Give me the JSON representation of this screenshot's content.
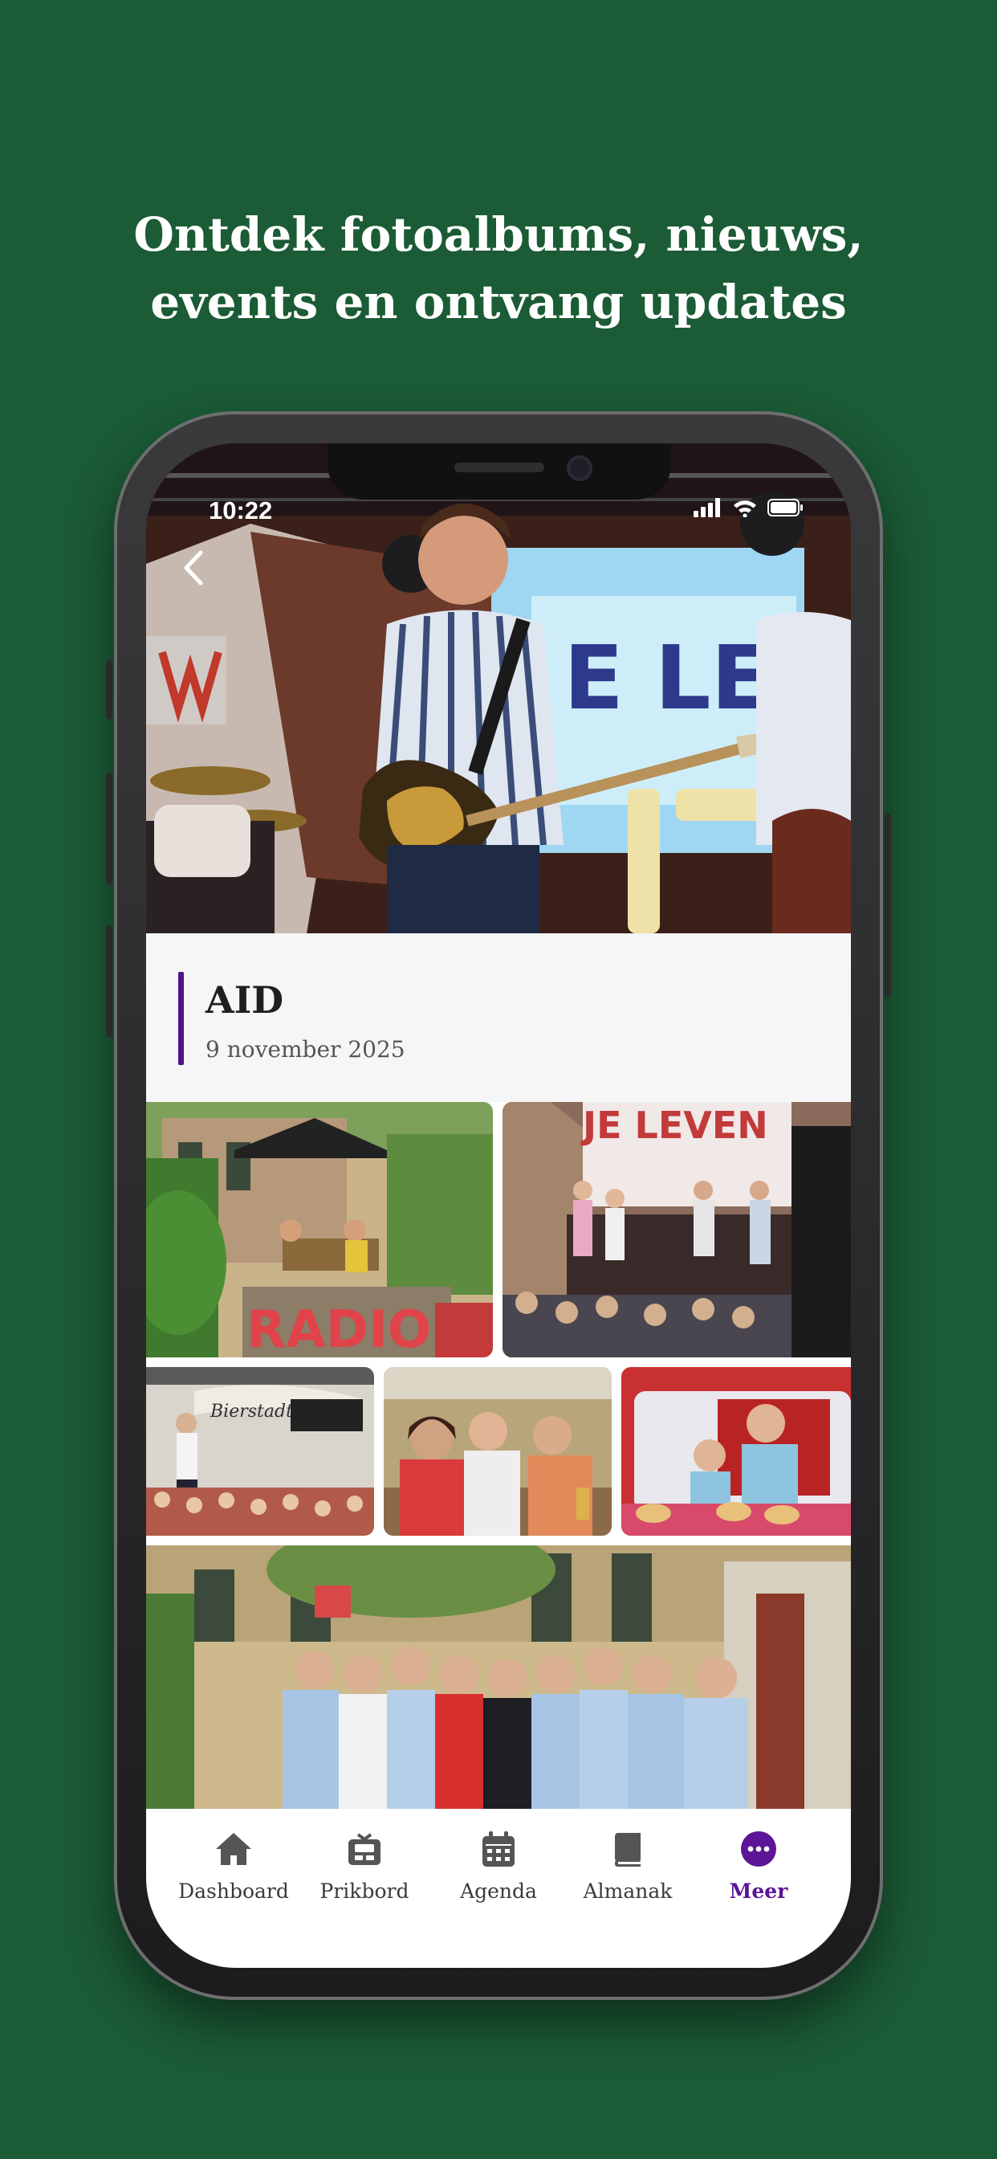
{
  "headline": {
    "line1": "Ontdek fotoalbums, nieuws,",
    "line2": "events en ontvang updates"
  },
  "status_bar": {
    "time": "10:22"
  },
  "album": {
    "title": "AID",
    "date": "9 november 2025"
  },
  "tabs": [
    {
      "label": "Dashboard",
      "icon": "home-icon",
      "active": false
    },
    {
      "label": "Prikbord",
      "icon": "board-icon",
      "active": false
    },
    {
      "label": "Agenda",
      "icon": "calendar-icon",
      "active": false
    },
    {
      "label": "Almanak",
      "icon": "book-icon",
      "active": false
    },
    {
      "label": "Meer",
      "icon": "more-icon",
      "active": true
    }
  ],
  "colors": {
    "background": "#1b5b35",
    "accent": "#4f138a",
    "active_tab": "#5b1596"
  }
}
